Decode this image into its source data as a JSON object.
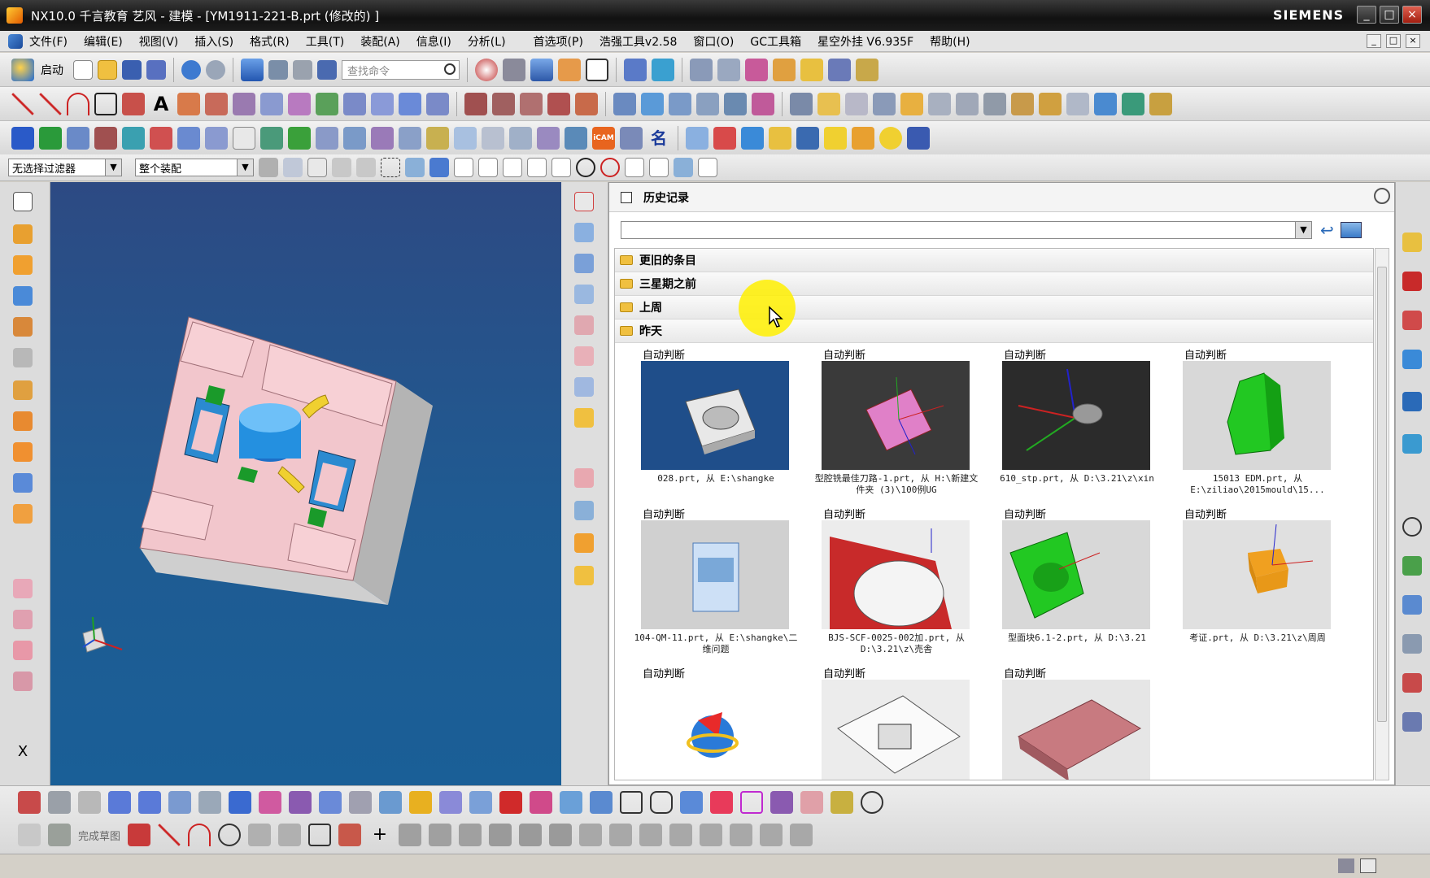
{
  "window": {
    "title": "NX10.0 千言教育 艺风 - 建模 - [YM1911-221-B.prt  (修改的) ]",
    "brand": "SIEMENS",
    "minimize": "_",
    "maximize": "□",
    "close": "×"
  },
  "menu": [
    "文件(F)",
    "编辑(E)",
    "视图(V)",
    "插入(S)",
    "格式(R)",
    "工具(T)",
    "装配(A)",
    "信息(I)",
    "分析(L)",
    "首选项(P)",
    "浩强工具v2.58",
    "窗口(O)",
    "GC工具箱",
    "星空外挂 V6.935F",
    "帮助(H)"
  ],
  "toolbar": {
    "launch_label": "启动",
    "search_placeholder": "查找命令",
    "complete_sketch": "完成草图",
    "icam_label": "iCAM",
    "name_label": "名"
  },
  "filters": {
    "selection_filter": "无选择过滤器",
    "assembly_scope": "整个装配"
  },
  "history": {
    "title": "历史记录",
    "groups": [
      "更旧的条目",
      "三星期之前",
      "上周",
      "昨天"
    ],
    "items": [
      {
        "label": "自动判断",
        "caption": "028.prt, 从 E:\\shangke"
      },
      {
        "label": "自动判断",
        "caption": "型腔铣最佳刀路-1.prt, 从 H:\\新建文件夹 (3)\\100例UG"
      },
      {
        "label": "自动判断",
        "caption": "610_stp.prt, 从 D:\\3.21\\z\\xin"
      },
      {
        "label": "自动判断",
        "caption": "15013 EDM.prt, 从 E:\\ziliao\\2015mould\\15..."
      },
      {
        "label": "自动判断",
        "caption": "104-QM-11.prt, 从 E:\\shangke\\二维问题"
      },
      {
        "label": "自动判断",
        "caption": "BJS-SCF-0025-002加.prt, 从 D:\\3.21\\z\\売舎"
      },
      {
        "label": "自动判断",
        "caption": "型面块6.1-2.prt, 从 D:\\3.21"
      },
      {
        "label": "自动判断",
        "caption": "考证.prt, 从 D:\\3.21\\z\\周周"
      },
      {
        "label": "自动判断",
        "caption": ""
      },
      {
        "label": "自动判断",
        "caption": ""
      },
      {
        "label": "自动判断",
        "caption": ""
      }
    ]
  },
  "colors": {
    "viewport_top": "#2d4a83",
    "viewport_bottom": "#1a5f97",
    "part_face": "#f2c6cc",
    "highlight": "#ffef00"
  }
}
